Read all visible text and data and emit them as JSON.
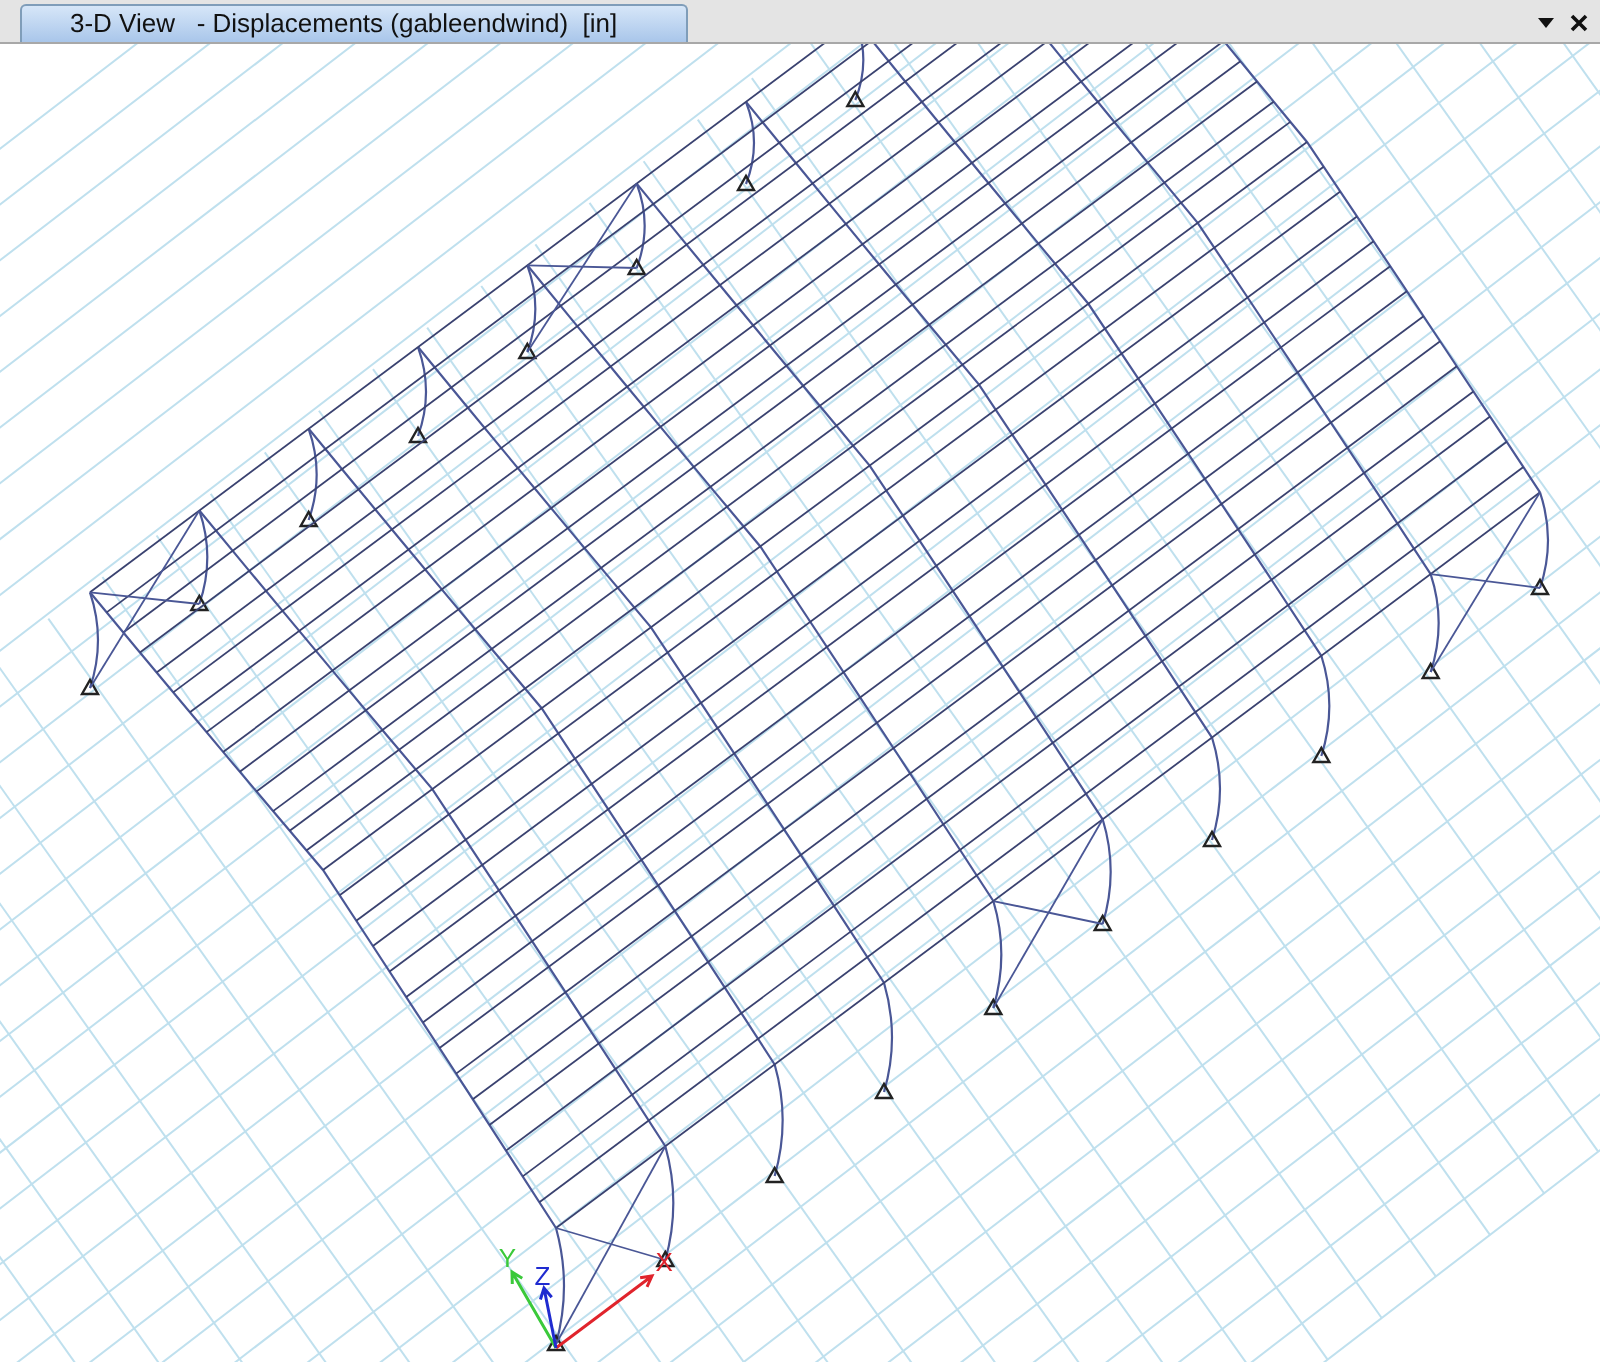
{
  "window": {
    "tab_title": "3-D View   - Displacements (gableendwind)  [in]"
  },
  "axes": [
    {
      "label": "X",
      "color": "#e0242c"
    },
    {
      "label": "Y",
      "color": "#3ac93a"
    },
    {
      "label": "Z",
      "color": "#1f2bd0"
    }
  ]
}
